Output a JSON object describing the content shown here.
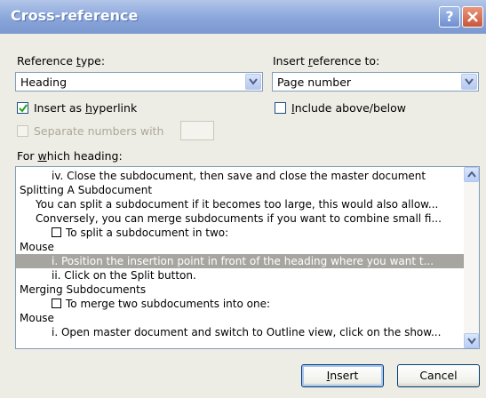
{
  "window": {
    "title": "Cross-reference"
  },
  "reference_type": {
    "label_pre": "Reference ",
    "label_u": "t",
    "label_post": "ype:",
    "value": "Heading"
  },
  "insert_reference_to": {
    "label_pre": "Insert ",
    "label_u": "r",
    "label_post": "eference to:",
    "value": "Page number"
  },
  "insert_hyperlink": {
    "label_pre": "Insert as ",
    "label_u": "h",
    "label_post": "yperlink",
    "checked": true
  },
  "include_above_below": {
    "label_pre": "",
    "label_u": "I",
    "label_post": "nclude above/below",
    "checked": false
  },
  "separate_numbers": {
    "label": "Separate numbers with",
    "checked": false,
    "disabled": true
  },
  "which_heading": {
    "label_pre": "For ",
    "label_u": "w",
    "label_post": "hich heading:",
    "items": [
      "iv. Close the subdocument, then save and close the master document",
      "Splitting A Subdocument",
      "You can split a subdocument if it becomes too large, this would also allow...",
      "Conversely, you can merge subdocuments if you want to combine small fi...",
      "To split a subdocument in two:",
      "Mouse",
      "i. Position the insertion point in front of the heading where you want t...",
      "ii. Click on the Split button.",
      "Merging Subdocuments",
      "To merge two subdocuments into one:",
      "Mouse",
      "i. Open master document and switch to Outline view, click on the show..."
    ]
  },
  "buttons": {
    "insert_pre": "",
    "insert_u": "I",
    "insert_post": "nsert",
    "cancel": "Cancel"
  }
}
